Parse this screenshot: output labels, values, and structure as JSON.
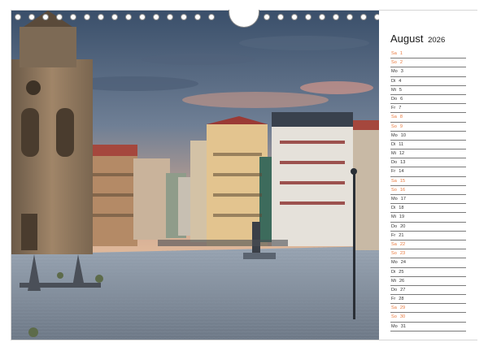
{
  "calendar": {
    "month": "August",
    "year": "2026",
    "days": [
      {
        "wd": "Sa",
        "d": "1"
      },
      {
        "wd": "So",
        "d": "2"
      },
      {
        "wd": "Mo",
        "d": "3"
      },
      {
        "wd": "Di",
        "d": "4"
      },
      {
        "wd": "Mi",
        "d": "5"
      },
      {
        "wd": "Do",
        "d": "6"
      },
      {
        "wd": "Fr",
        "d": "7"
      },
      {
        "wd": "Sa",
        "d": "8"
      },
      {
        "wd": "So",
        "d": "9"
      },
      {
        "wd": "Mo",
        "d": "10"
      },
      {
        "wd": "Di",
        "d": "11"
      },
      {
        "wd": "Mi",
        "d": "12"
      },
      {
        "wd": "Do",
        "d": "13"
      },
      {
        "wd": "Fr",
        "d": "14"
      },
      {
        "wd": "Sa",
        "d": "15"
      },
      {
        "wd": "So",
        "d": "16"
      },
      {
        "wd": "Mo",
        "d": "17"
      },
      {
        "wd": "Di",
        "d": "18"
      },
      {
        "wd": "Mi",
        "d": "19"
      },
      {
        "wd": "Do",
        "d": "20"
      },
      {
        "wd": "Fr",
        "d": "21"
      },
      {
        "wd": "Sa",
        "d": "22"
      },
      {
        "wd": "So",
        "d": "23"
      },
      {
        "wd": "Mo",
        "d": "24"
      },
      {
        "wd": "Di",
        "d": "25"
      },
      {
        "wd": "Mi",
        "d": "26"
      },
      {
        "wd": "Do",
        "d": "27"
      },
      {
        "wd": "Fr",
        "d": "28"
      },
      {
        "wd": "Sa",
        "d": "29"
      },
      {
        "wd": "So",
        "d": "30"
      },
      {
        "wd": "Mo",
        "d": "31"
      }
    ]
  },
  "colors": {
    "weekend": "#e8783c",
    "weekday": "#333333",
    "ring": "#8a8a8a"
  }
}
